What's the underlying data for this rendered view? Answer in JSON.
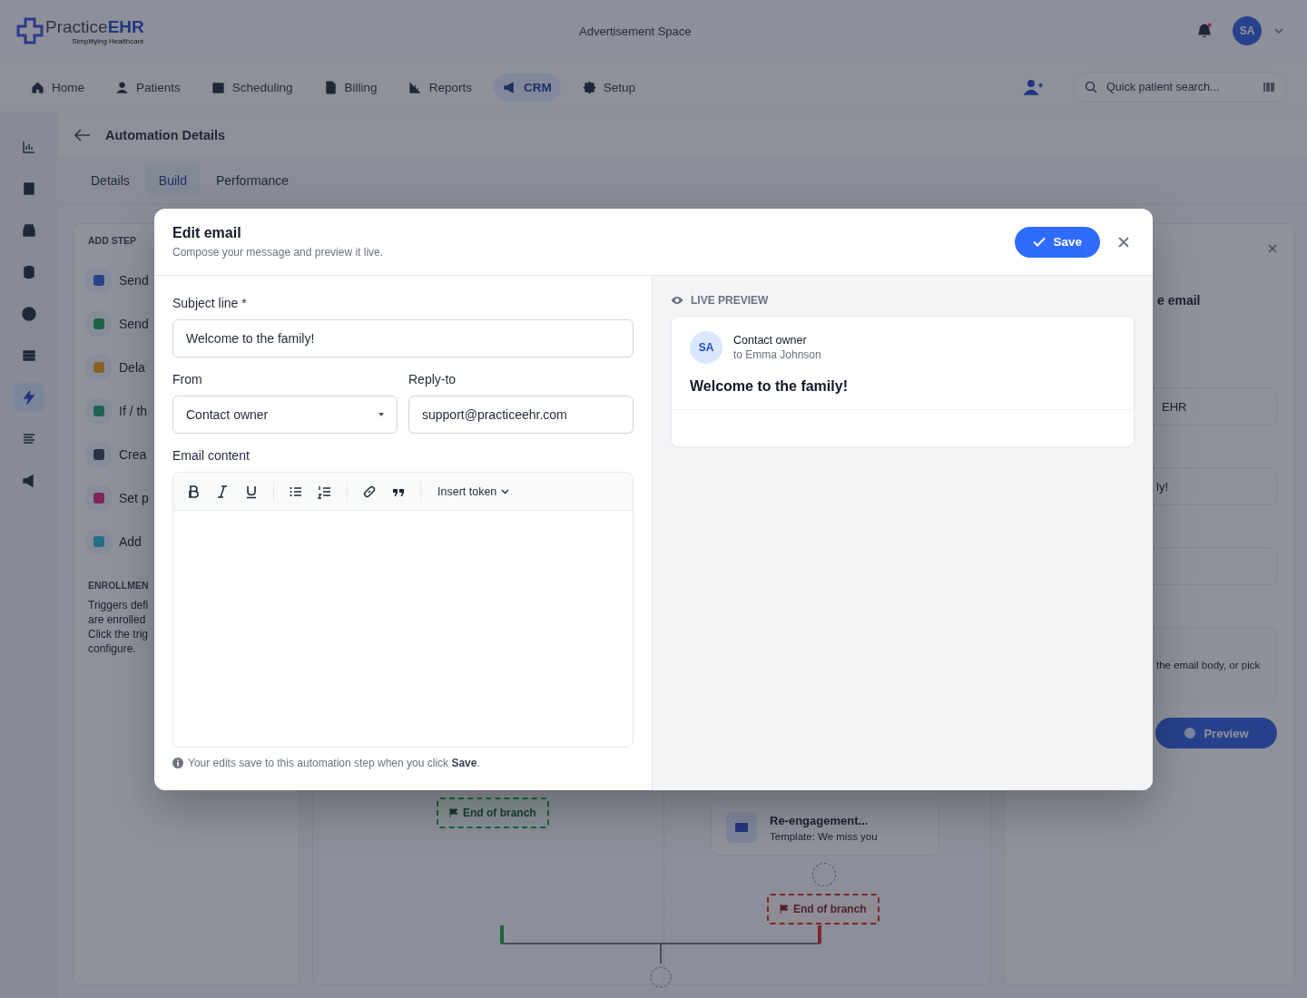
{
  "header": {
    "logo_primary": "Practice",
    "logo_accent": "EHR",
    "logo_tagline": "Simplifying Healthcare",
    "ad_space": "Advertisement Space",
    "notification_dot": true,
    "avatar": "SA"
  },
  "nav": {
    "items": [
      {
        "label": "Home",
        "selected": false
      },
      {
        "label": "Patients",
        "selected": false
      },
      {
        "label": "Scheduling",
        "selected": false
      },
      {
        "label": "Billing",
        "selected": false
      },
      {
        "label": "Reports",
        "selected": false
      },
      {
        "label": "CRM",
        "selected": true
      },
      {
        "label": "Setup",
        "selected": false
      }
    ],
    "search": {
      "placeholder": "Quick patient search..."
    }
  },
  "sidebar": {
    "items": [
      {
        "selected": false
      },
      {
        "selected": false
      },
      {
        "selected": false
      },
      {
        "selected": false
      },
      {
        "selected": false
      },
      {
        "selected": false
      },
      {
        "selected": true
      },
      {
        "selected": false
      },
      {
        "selected": false
      }
    ]
  },
  "page": {
    "title": "Automation Details",
    "tabs": [
      {
        "label": "Details",
        "selected": false
      },
      {
        "label": "Build",
        "selected": true
      },
      {
        "label": "Performance",
        "selected": false
      }
    ]
  },
  "add_step": {
    "title": "ADD STEP",
    "items": [
      {
        "label": "Send",
        "kind": "email"
      },
      {
        "label": "Send",
        "kind": "sms"
      },
      {
        "label": "Dela",
        "kind": "delay"
      },
      {
        "label": "If / th",
        "kind": "branch"
      },
      {
        "label": "Crea",
        "kind": "task"
      },
      {
        "label": "Set p",
        "kind": "property"
      },
      {
        "label": "Add",
        "kind": "list"
      }
    ]
  },
  "enrollment": {
    "title": "ENROLLMEN",
    "lines": [
      "Triggers defi",
      "are enrolled",
      "Click the trig",
      "configure."
    ]
  },
  "canvas": {
    "branch_ends": [
      {
        "label": "End of branch",
        "kind": "yes"
      },
      {
        "label": "End of branch",
        "kind": "no"
      }
    ],
    "step": {
      "title": "Re-engagement...",
      "template": "Template: We miss you"
    }
  },
  "right_panel": {
    "heading": "e email",
    "from_value": "EHR",
    "subject_value": "ly!",
    "hint": "the email body, or pick",
    "preview_button": "Preview"
  },
  "modal": {
    "title": "Edit email",
    "subtitle": "Compose your message and preview it live.",
    "save": "Save",
    "subject": {
      "label": "Subject line *",
      "value": "Welcome to the family!"
    },
    "from": {
      "label": "From",
      "value": "Contact owner"
    },
    "reply_to": {
      "label": "Reply-to",
      "value": "support@practiceehr.com"
    },
    "content": {
      "label": "Email content",
      "toolbar": [
        [
          {
            "kind": "bold"
          },
          {
            "kind": "italic"
          },
          {
            "kind": "underline"
          }
        ],
        [
          {
            "kind": "bullet_list"
          },
          {
            "kind": "numbered_list"
          }
        ],
        [
          {
            "kind": "link"
          },
          {
            "kind": "quote"
          }
        ]
      ],
      "token_menu": "Insert token"
    },
    "note": "Your edits save to this automation step when you click **Save**.",
    "preview": {
      "heading": "LIVE PREVIEW",
      "avatar": "SA",
      "sender": "Contact owner",
      "recipient": "to Emma Johnson",
      "subject": "Welcome to the family!"
    }
  }
}
